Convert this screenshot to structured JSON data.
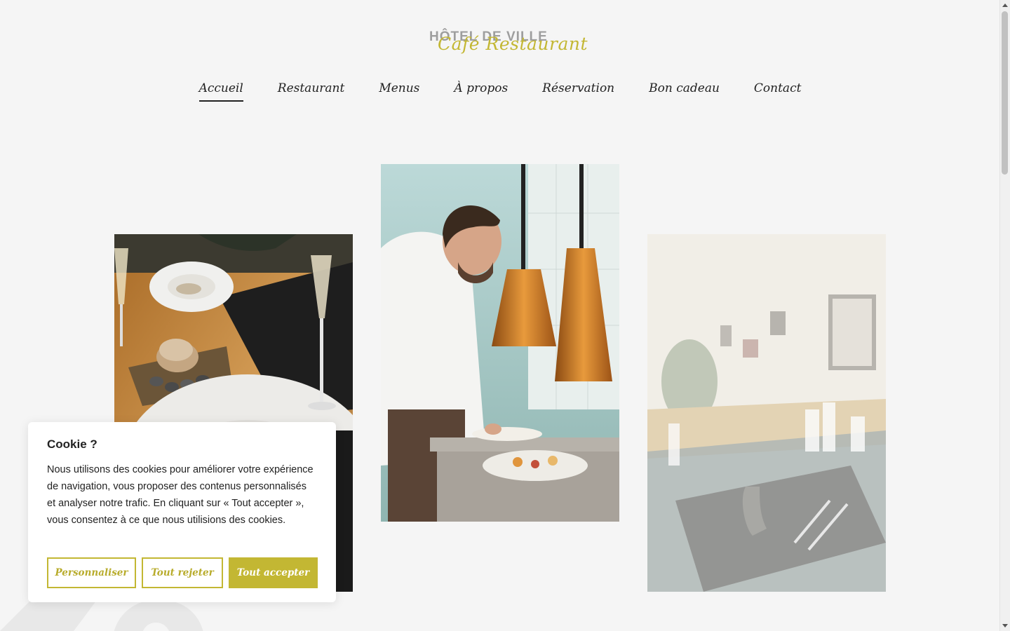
{
  "brand": {
    "name_top": "HÔTEL DE VILLE",
    "name_script": "Café Restaurant"
  },
  "nav": {
    "items": [
      {
        "label": "Accueil",
        "active": true
      },
      {
        "label": "Restaurant",
        "active": false
      },
      {
        "label": "Menus",
        "active": false
      },
      {
        "label": "À propos",
        "active": false
      },
      {
        "label": "Réservation",
        "active": false
      },
      {
        "label": "Bon cadeau",
        "active": false
      },
      {
        "label": "Contact",
        "active": false
      }
    ]
  },
  "gallery": {
    "photos": [
      {
        "subject": "table-setting-with-bread-and-wine"
      },
      {
        "subject": "chef-plating-under-heat-lamps"
      },
      {
        "subject": "restaurant-dining-room"
      }
    ]
  },
  "cookie_banner": {
    "title": "Cookie ?",
    "text": "Nous utilisons des cookies pour améliorer votre expérience de navigation, vous proposer des contenus personnalisés et analyser notre trafic. En cliquant sur « Tout accepter », vous consentez à ce que nous utilisions des cookies.",
    "customize_label": "Personnaliser",
    "reject_label": "Tout rejeter",
    "accept_label": "Tout accepter"
  },
  "colors": {
    "accent": "#c3b733",
    "background": "#f5f5f5",
    "text": "#222222"
  }
}
